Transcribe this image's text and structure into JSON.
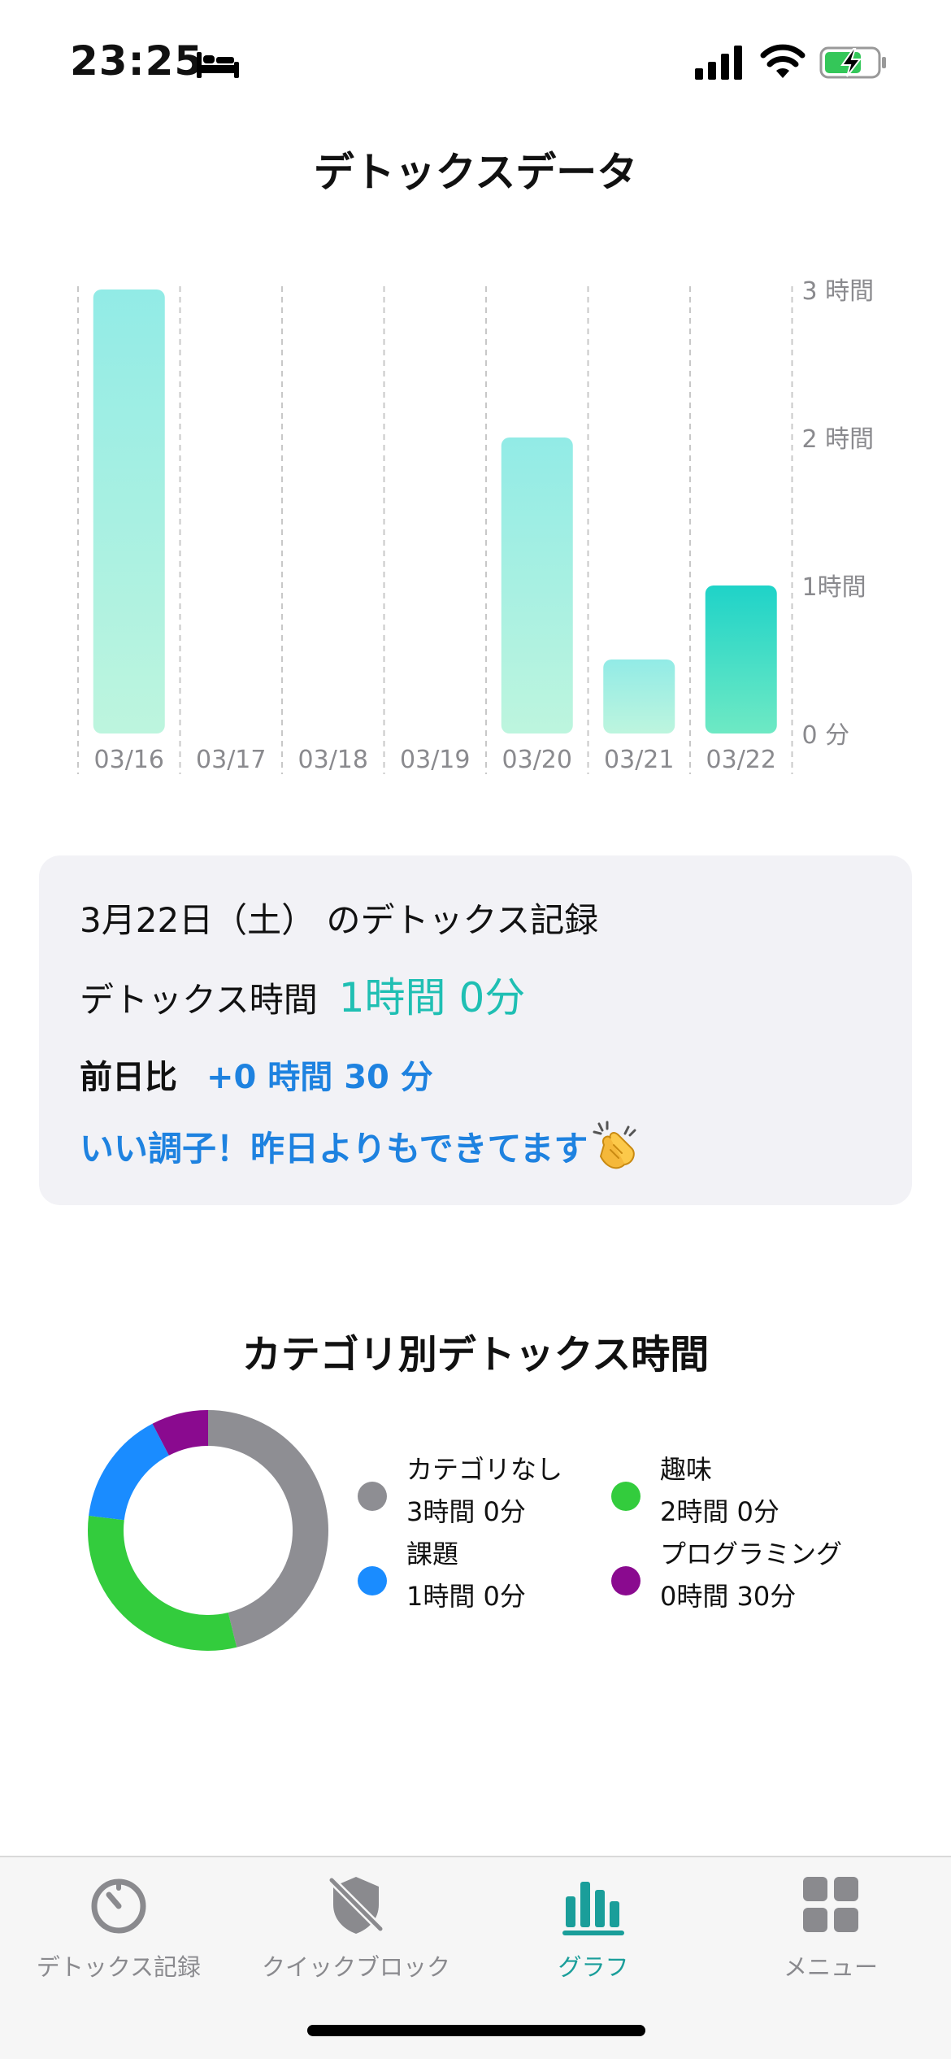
{
  "status_bar": {
    "time": "23:25"
  },
  "page_title": "デトックスデータ",
  "chart_data": {
    "type": "bar",
    "categories": [
      "03/16",
      "03/17",
      "03/18",
      "03/19",
      "03/20",
      "03/21",
      "03/22"
    ],
    "values": [
      3,
      0,
      0,
      0,
      2,
      0.5,
      1
    ],
    "unit": "hours",
    "ylim": [
      0,
      3
    ],
    "y_ticks": [
      {
        "value": 3,
        "label": "3 時間"
      },
      {
        "value": 2,
        "label": "2 時間"
      },
      {
        "value": 1,
        "label": "1時間"
      },
      {
        "value": 0,
        "label": "0 分"
      }
    ],
    "y_axis_position": "right",
    "highlighted_category": "03/22",
    "colors": {
      "bar_top": "#92ebe6",
      "bar_bottom": "#bdf5de",
      "highlight_top": "#1fd3c8",
      "highlight_bottom": "#6ee9c4",
      "grid": "#c8c8c8"
    }
  },
  "summary": {
    "title": "3月22日（土） のデトックス記録",
    "detox_label": "デトックス時間",
    "detox_value": "1時間 0分",
    "compare_label": "前日比",
    "compare_value": "+0 時間 30 分",
    "encouragement": "いい調子！昨日よりもできてます",
    "encouragement_icon": "clapping-hands-icon"
  },
  "category": {
    "title": "カテゴリ別デトックス時間",
    "items": [
      {
        "name": "カテゴリなし",
        "value": "3時間 0分",
        "minutes": 180,
        "color": "#8e8e93"
      },
      {
        "name": "趣味",
        "value": "2時間 0分",
        "minutes": 120,
        "color": "#33cc3d"
      },
      {
        "name": "課題",
        "value": "1時間 0分",
        "minutes": 60,
        "color": "#1a8cff"
      },
      {
        "name": "プログラミング",
        "value": "0時間 30分",
        "minutes": 30,
        "color": "#8a0a8f"
      }
    ]
  },
  "tabs": [
    {
      "label": "デトックス記録",
      "icon": "timer-icon",
      "active": false
    },
    {
      "label": "クイックブロック",
      "icon": "shield-slash-icon",
      "active": false
    },
    {
      "label": "グラフ",
      "icon": "bar-chart-icon",
      "active": true
    },
    {
      "label": "メニュー",
      "icon": "grid-icon",
      "active": false
    }
  ]
}
